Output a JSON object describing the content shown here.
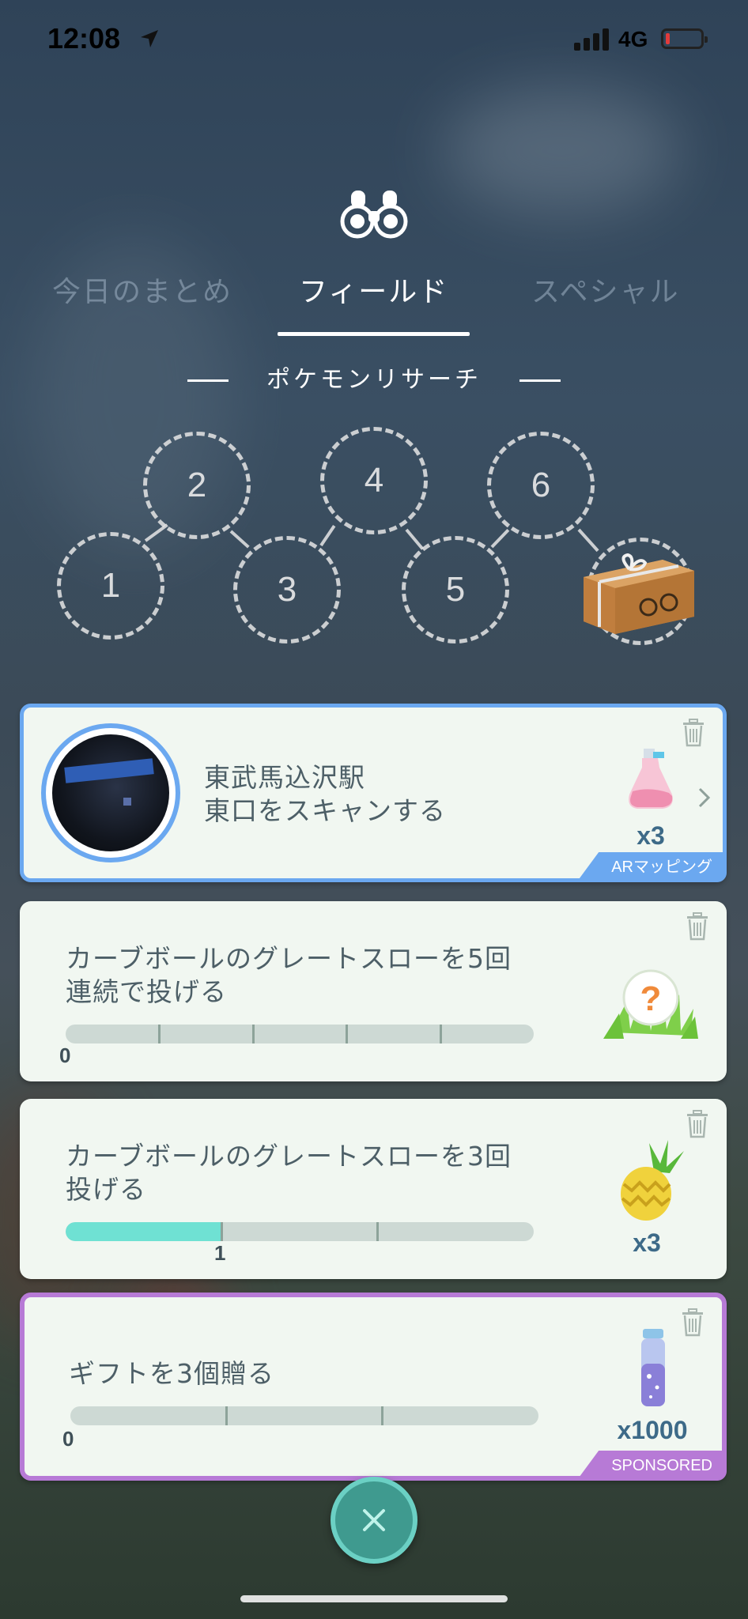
{
  "status_bar": {
    "time": "12:08",
    "network": "4G"
  },
  "tabs": [
    {
      "label": "今日のまとめ",
      "active": false
    },
    {
      "label": "フィールド",
      "active": true
    },
    {
      "label": "スペシャル",
      "active": false
    }
  ],
  "section_title": "ポケモンリサーチ",
  "steps": [
    "1",
    "2",
    "3",
    "4",
    "5",
    "6"
  ],
  "tasks": [
    {
      "title_line1": "東武馬込沢駅",
      "title_line2": "東口をスキャンする",
      "reward_icon": "mystery-potion-icon",
      "reward_qty": "x3",
      "tag": "ARマッピング",
      "accent": "#6ba8f0"
    },
    {
      "title_line1": "カーブボールのグレートスローを5回",
      "title_line2": "連続で投げる",
      "progress_value": "0",
      "progress_fraction": 0,
      "reward_icon": "encounter-question-icon"
    },
    {
      "title_line1": "カーブボールのグレートスローを3回",
      "title_line2": "投げる",
      "progress_value": "1",
      "progress_fraction": 0.3333,
      "reward_icon": "golden-pinap-berry-icon",
      "reward_qty": "x3"
    },
    {
      "title_line1": "ギフトを3個贈る",
      "progress_value": "0",
      "progress_fraction": 0,
      "reward_icon": "stardust-bottle-icon",
      "reward_qty": "x1000",
      "tag": "SPONSORED",
      "accent": "#b77ad6"
    }
  ],
  "colors": {
    "progress_fill": "#6fe1d3",
    "ar_accent": "#6ba8f0",
    "sponsored_accent": "#b77ad6",
    "close_button": "#3f9a8f"
  }
}
